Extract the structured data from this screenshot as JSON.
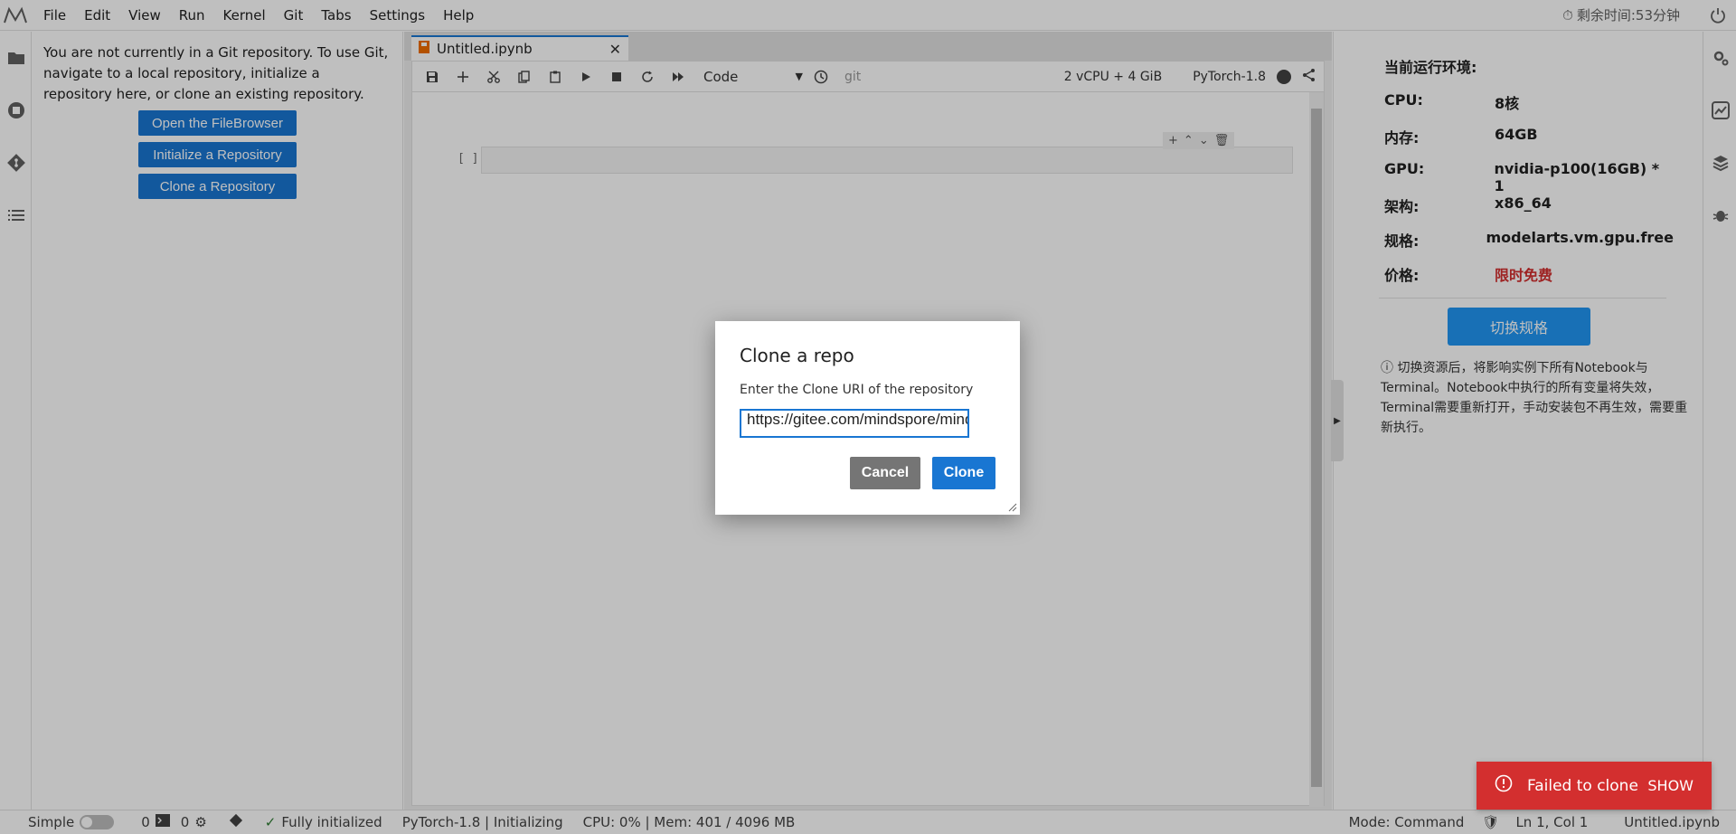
{
  "menubar": {
    "items": [
      "File",
      "Edit",
      "View",
      "Run",
      "Kernel",
      "Git",
      "Tabs",
      "Settings",
      "Help"
    ],
    "timer": "剩余时间:53分钟"
  },
  "git_panel": {
    "message": "You are not currently in a Git repository. To use Git, navigate to a local repository, initialize a repository here, or clone an existing repository.",
    "buttons": [
      "Open the FileBrowser",
      "Initialize a Repository",
      "Clone a Repository"
    ]
  },
  "tab": {
    "title": "Untitled.ipynb",
    "close": "✕"
  },
  "toolbar": {
    "cell_type": "Code",
    "git_label": "git",
    "resources": "2 vCPU + 4 GiB",
    "kernel": "PyTorch-1.8"
  },
  "cell": {
    "prompt": "[ ]"
  },
  "right_panel": {
    "title": "当前运行环境:",
    "rows": [
      {
        "key": "CPU:",
        "value": "8核"
      },
      {
        "key": "内存:",
        "value": "64GB"
      },
      {
        "key": "GPU:",
        "value": "nvidia-p100(16GB) * 1"
      },
      {
        "key": "架构:",
        "value": "x86_64"
      },
      {
        "key": "规格:",
        "value": "modelarts.vm.gpu.free"
      },
      {
        "key": "价格:",
        "value": "限时免费"
      }
    ],
    "switch_button": "切换规格",
    "note": "切换资源后，将影响实例下所有Notebook与Terminal。Notebook中执行的所有变量将失效，Terminal需要重新打开，手动安装包不再生效，需要重新执行。"
  },
  "statusbar": {
    "mode_label": "Simple",
    "terminals": "0",
    "kernels": "0",
    "git_status": "Fully initialized",
    "kernel_status": "PyTorch-1.8 | Initializing",
    "resources": "CPU: 0% | Mem: 401 / 4096 MB",
    "mode": "Mode: Command",
    "position": "Ln 1, Col 1",
    "file": "Untitled.ipynb"
  },
  "dialog": {
    "title": "Clone a repo",
    "label": "Enter the Clone URI of the repository",
    "input_value": "https://gitee.com/mindspore/mindspore",
    "cancel": "Cancel",
    "clone": "Clone"
  },
  "toast": {
    "message": "Failed to clone",
    "action": "SHOW"
  },
  "colors": {
    "accent": "#1976d2",
    "error": "#d32f2f",
    "price": "#d32f2f"
  }
}
